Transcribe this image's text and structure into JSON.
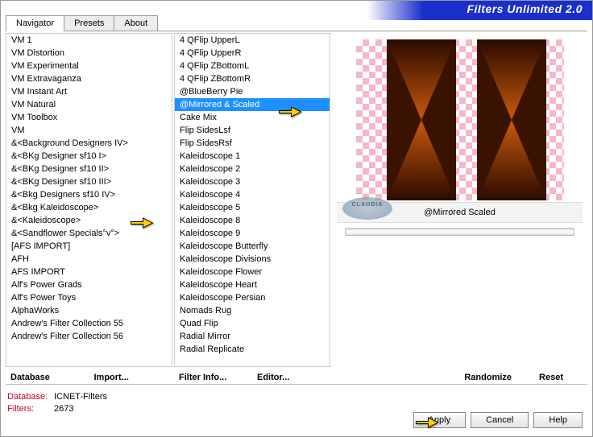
{
  "banner": "Filters Unlimited 2.0",
  "tabs": {
    "t0": "Navigator",
    "t1": "Presets",
    "t2": "About"
  },
  "categories": [
    "VM 1",
    "VM Distortion",
    "VM Experimental",
    "VM Extravaganza",
    "VM Instant Art",
    "VM Natural",
    "VM Toolbox",
    "VM",
    "&<Background Designers IV>",
    "&<BKg Designer sf10 I>",
    "&<BKg Designer sf10 II>",
    "&<BKg Designer sf10 III>",
    "&<Bkg Designers sf10 IV>",
    "&<Bkg Kaleidoscope>",
    "&<Kaleidoscope>",
    "&<Sandflower Specials°v°>",
    "[AFS IMPORT]",
    "AFH",
    "AFS IMPORT",
    "Alf's Power Grads",
    "Alf's Power Toys",
    "AlphaWorks",
    "Andrew's Filter Collection 55",
    "Andrew's Filter Collection 56"
  ],
  "filters": [
    "4 QFlip UpperL",
    "4 QFlip UpperR",
    "4 QFlip ZBottomL",
    "4 QFlip ZBottomR",
    "@BlueBerry Pie",
    "@Mirrored & Scaled",
    "Cake Mix",
    "Flip SidesLsf",
    "Flip SidesRsf",
    "Kaleidoscope 1",
    "Kaleidoscope 2",
    "Kaleidoscope 3",
    "Kaleidoscope 4",
    "Kaleidoscope 5",
    "Kaleidoscope 8",
    "Kaleidoscope 9",
    "Kaleidoscope Butterfly",
    "Kaleidoscope Divisions",
    "Kaleidoscope Flower",
    "Kaleidoscope Heart",
    "Kaleidoscope Persian",
    "Nomads Rug",
    "Quad Flip",
    "Radial Mirror",
    "Radial Replicate"
  ],
  "selected_category_index": 13,
  "selected_filter_index": 5,
  "cat_actions": {
    "a0": "Database",
    "a1": "Import..."
  },
  "filter_actions": {
    "a0": "Filter Info...",
    "a1": "Editor..."
  },
  "preview_label": "@Mirrored  Scaled",
  "right_actions": {
    "a0": "Randomize",
    "a1": "Reset"
  },
  "footer": {
    "k0": "Database:",
    "v0": "ICNET-Filters",
    "k1": "Filters:",
    "v1": "2673"
  },
  "buttons": {
    "apply": "Apply",
    "cancel": "Cancel",
    "help": "Help"
  },
  "watermark": "CLAUDIA"
}
